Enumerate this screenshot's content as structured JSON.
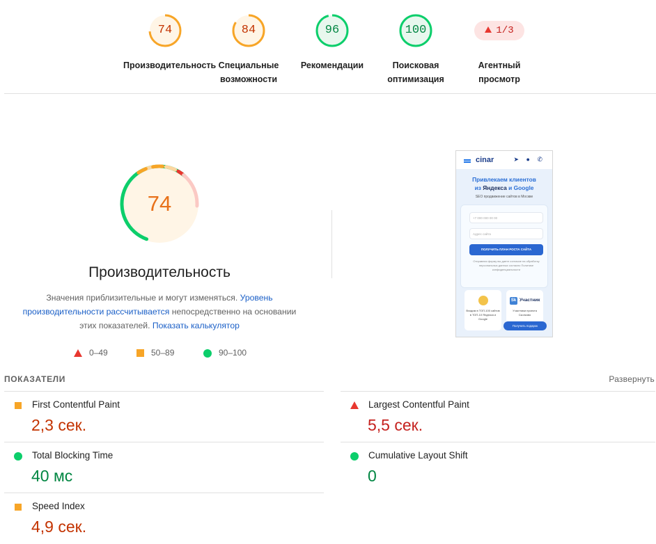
{
  "categories": [
    {
      "score": "74",
      "label_line1": "Производительность",
      "label_line2": "",
      "status": "average"
    },
    {
      "score": "84",
      "label_line1": "Специальные",
      "label_line2": "возможности",
      "status": "average"
    },
    {
      "score": "96",
      "label_line1": "Рекомендации",
      "label_line2": "",
      "status": "pass"
    },
    {
      "score": "100",
      "label_line1": "Поисковая",
      "label_line2": "оптимизация",
      "status": "pass"
    },
    {
      "score": "1/3",
      "label_line1": "Агентный",
      "label_line2": "просмотр",
      "status": "fail"
    }
  ],
  "performance": {
    "score": "74",
    "title": "Производительность",
    "desc_part1": "Значения приблизительные и могут изменяться. ",
    "desc_link1": "Уровень производительности рассчитывается",
    "desc_part2": " непосредственно на основании этих показателей. ",
    "desc_link2": "Показать калькулятор"
  },
  "legend": {
    "fail": "0–49",
    "average": "50–89",
    "pass": "90–100"
  },
  "screenshot": {
    "logo": "cinar",
    "icons": "➤ ● ✆",
    "headline_line1": "Привлекаем клиентов",
    "headline_line2_pre": "из ",
    "headline_yandex": "Яндекса",
    "headline_mid": " и ",
    "headline_google": "Google",
    "subtitle": "SEO продвижение сайтов в Москве",
    "phone_placeholder": "+7 000 000 00 00",
    "site_placeholder": "Адрес сайта",
    "button": "ПОЛУЧИТЬ ПЛАН РОСТА САЙТА",
    "note": "Отправляя форму вы даете согласие на обработку персональных данных согласно Политике конфиденциальности",
    "card1_text": "Входим в ТОП-100 сайтов в ТОП-10 Яндекса и Google",
    "card2_logo": "Sk",
    "card2_title": "Участник",
    "card2_text": "Участники проекта Сколково",
    "chip": "Получить подарок"
  },
  "metrics_section": {
    "title": "ПОКАЗАТЕЛИ",
    "expand": "Развернуть"
  },
  "metrics": [
    {
      "name": "First Contentful Paint",
      "value": "2,3 сек.",
      "status": "average"
    },
    {
      "name": "Largest Contentful Paint",
      "value": "5,5 сек.",
      "status": "fail"
    },
    {
      "name": "Total Blocking Time",
      "value": "40 мс",
      "status": "pass"
    },
    {
      "name": "Cumulative Layout Shift",
      "value": "0",
      "status": "pass"
    },
    {
      "name": "Speed Index",
      "value": "4,9 сек.",
      "status": "average"
    }
  ],
  "colors": {
    "average": "#f7a527",
    "average_text": "#c33300",
    "average_bg": "#fff5e6",
    "pass": "#0cce6b",
    "pass_text": "#018642",
    "pass_bg": "#e8f7ee",
    "fail": "#e8372f",
    "fail_text": "#c5221f",
    "fail_bg": "#fde4e3",
    "link": "#1a5fc7"
  }
}
